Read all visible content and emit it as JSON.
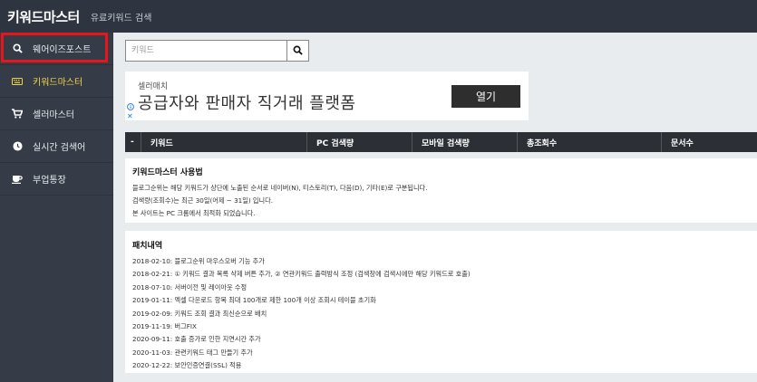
{
  "header": {
    "title": "키워드마스터",
    "subtitle": "유료키워드 검색"
  },
  "sidebar": {
    "items": [
      {
        "label": "웨어이즈포스트",
        "icon": "search-icon"
      },
      {
        "label": "키워드마스터",
        "icon": "keyboard-icon"
      },
      {
        "label": "셀러마스터",
        "icon": "cart-icon"
      },
      {
        "label": "실시간 검색어",
        "icon": "clock-icon"
      },
      {
        "label": "부업통장",
        "icon": "coffee-icon"
      }
    ]
  },
  "search": {
    "placeholder": "키워드",
    "value": ""
  },
  "ad": {
    "label": "셀러매치",
    "title": "공급자와 판매자 직거래 플랫폼",
    "button": "열기"
  },
  "table": {
    "headers": [
      "-",
      "키워드",
      "PC 검색량",
      "모바일 검색량",
      "총조회수",
      "문서수"
    ]
  },
  "howto": {
    "title": "키워드마스터 사용법",
    "lines": [
      "블로그순위는 해당 키워드가 상단에 노출된 순서로 네이버(N), 티스토리(T), 다음(D), 기타(E)로 구분됩니다.",
      "검색량(조회수)는 최근 30일(어제 ~ 31일) 입니다.",
      "본 사이트는 PC 크롬에서 최적화 되었습니다."
    ]
  },
  "patch": {
    "title": "패치내역",
    "lines": [
      "2018-02-10: 블로그순위 마우스오버 기능 추가",
      "2018-02-21: ① 키워드 결과 목록 삭제 버튼 추가, ② 연관키워드 출력방식 조정 (검색창에 검색시에만 해당 키워드로 호출)",
      "2018-07-10: 서버이전 및 레이아웃 수정",
      "2019-01-11: 엑셀 다운로드 항목 최대 100개로 제한 100개 이상 조회시 테이블 초기화",
      "2019-02-09: 키워드 조회 결과 최신순으로 배치",
      "2019-11-19: 버그FIX",
      "2020-09-11: 호출 증가로 인한 지연시간 추가",
      "2020-11-03: 관련키워드 태그 만들기 추가",
      "2020-12-22: 보안인증연결(SSL) 적용"
    ]
  }
}
